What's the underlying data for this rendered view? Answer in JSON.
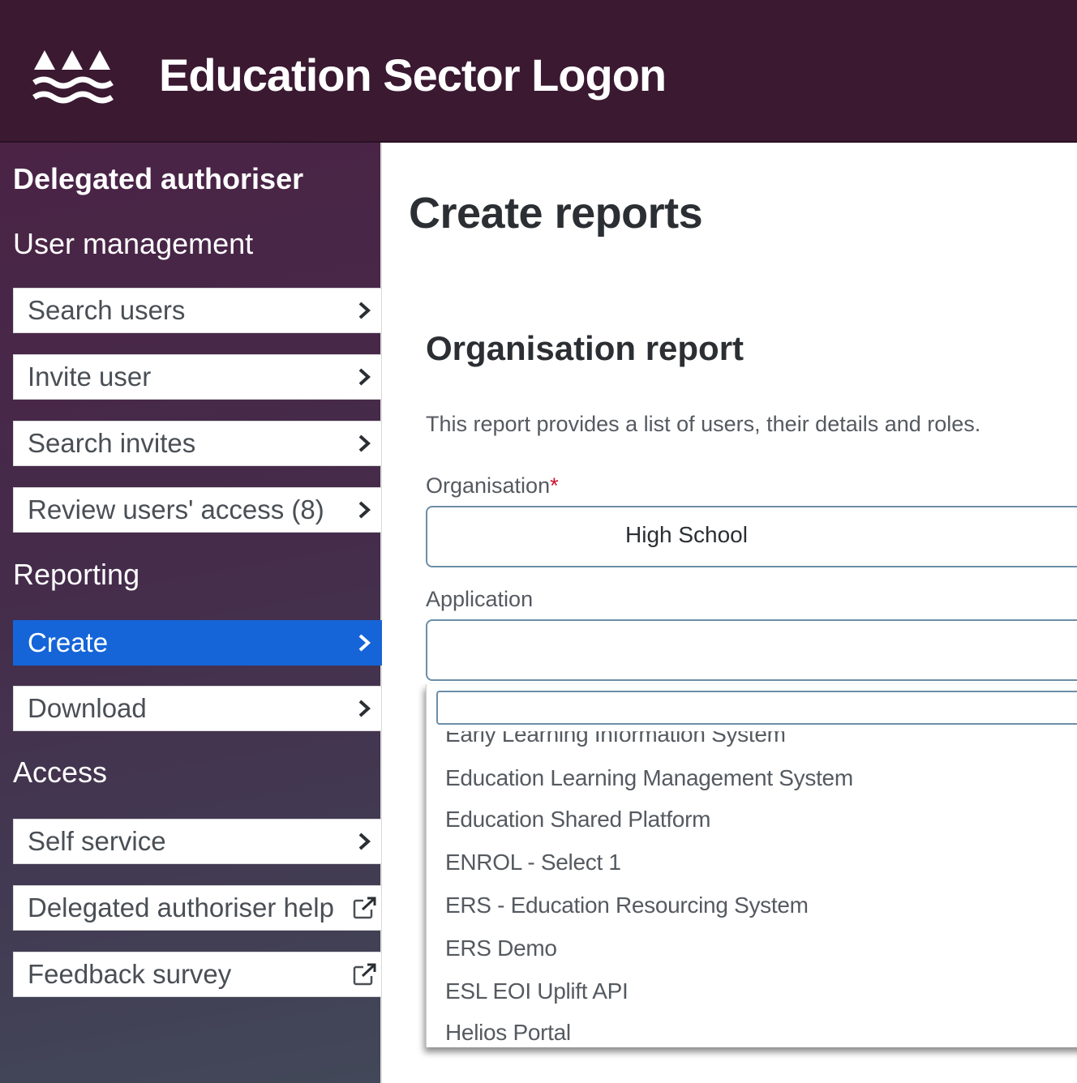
{
  "header": {
    "app_title": "Education Sector Logon",
    "logo_icon": "mountains-waves-logo",
    "background_color": "#3a1931"
  },
  "sidebar": {
    "role_heading": "Delegated authoriser",
    "sections": [
      {
        "title": "User management",
        "items": [
          {
            "label": "Search users",
            "icon": "chevron-right-icon"
          },
          {
            "label": "Invite user",
            "icon": "chevron-right-icon"
          },
          {
            "label": "Search invites",
            "icon": "chevron-right-icon"
          },
          {
            "label": "Review users' access (8)",
            "icon": "chevron-right-icon"
          }
        ]
      },
      {
        "title": "Reporting",
        "items": [
          {
            "label": "Create",
            "icon": "chevron-right-icon",
            "active": true
          },
          {
            "label": "Download",
            "icon": "chevron-right-icon"
          }
        ]
      },
      {
        "title": "Access",
        "items": [
          {
            "label": "Self service",
            "icon": "chevron-right-icon"
          },
          {
            "label": "Delegated authoriser help",
            "icon": "external-link-icon"
          },
          {
            "label": "Feedback survey",
            "icon": "external-link-icon"
          }
        ]
      }
    ],
    "active_color": "#1565d8"
  },
  "main": {
    "page_title": "Create reports",
    "section_title": "Organisation report",
    "description": "This report provides a list of users, their details and roles.",
    "organisation": {
      "label": "Organisation",
      "required_marker": "*",
      "value": "High School"
    },
    "application": {
      "label": "Application",
      "value": "",
      "search_value": "",
      "options": [
        "Early Learning Information System",
        "Education Learning Management System",
        "Education Shared Platform",
        "ENROL - Select 1",
        "ERS - Education Resourcing System",
        "ERS Demo",
        "ESL EOI Uplift API",
        "Helios Portal"
      ]
    }
  }
}
